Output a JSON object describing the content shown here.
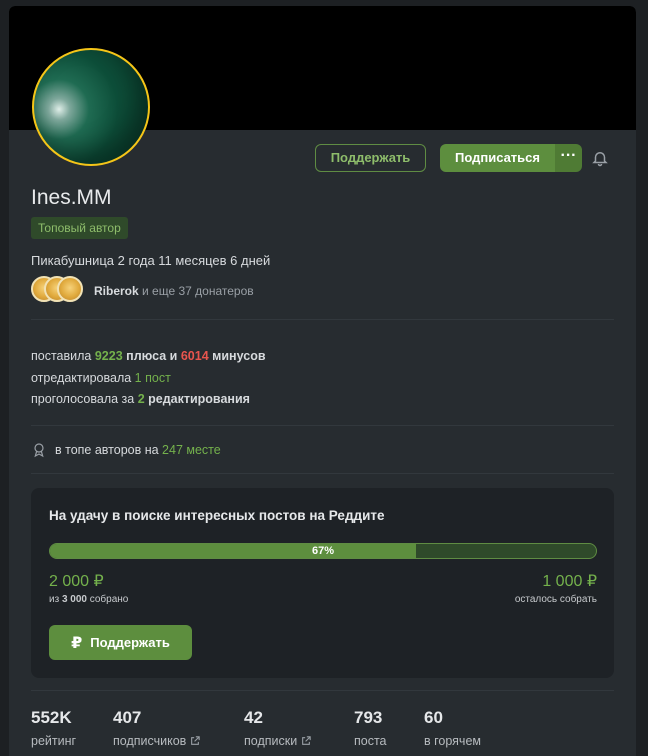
{
  "profile": {
    "username": "Ines.MM",
    "badge": "Топовый автор",
    "since": "Пикабушница 2 года 11 месяцев 6 дней",
    "donor_name": "Riberok",
    "donor_rest": " и еще 37 донатеров"
  },
  "actions": {
    "support_label": "Поддержать",
    "subscribe_label": "Подписаться",
    "more_label": "···"
  },
  "activity": {
    "line1_prefix": "поставила ",
    "pluses": "9223",
    "line1_mid": " плюса и ",
    "minuses": "6014",
    "line1_suffix": " минусов",
    "line2_prefix": "отредактировала ",
    "edited": "1 пост",
    "line3_prefix": "проголосовала за ",
    "votes": "2",
    "line3_suffix": " редактирования"
  },
  "top": {
    "prefix": "в топе авторов на ",
    "place": "247 месте"
  },
  "fundraiser": {
    "title": "На удачу в поиске интересных постов на Реддите",
    "progress_percent": 67,
    "progress_label": "67%",
    "collected": "2 000 ₽",
    "collected_sub_prefix": "из ",
    "goal": "3 000",
    "collected_sub_suffix": " собрано",
    "remaining": "1 000 ₽",
    "remaining_sub": "осталось собрать",
    "button_label": "Поддержать"
  },
  "stats": [
    {
      "value": "552K",
      "label": "рейтинг"
    },
    {
      "value": "407",
      "label": "подписчиков"
    },
    {
      "value": "42",
      "label": "подписки"
    },
    {
      "value": "793",
      "label": "поста"
    },
    {
      "value": "60",
      "label": "в горячем"
    }
  ],
  "colors": {
    "accent_green": "#5d8e3e",
    "text_green": "#74b14c",
    "minus_red": "#e8554e",
    "avatar_border": "#f5c518"
  }
}
